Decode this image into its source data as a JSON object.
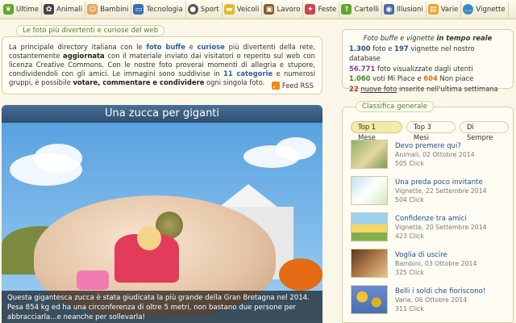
{
  "nav": [
    {
      "label": "Ultime",
      "icon": "leaf-icon",
      "color": "#5ca832"
    },
    {
      "label": "Animali",
      "icon": "paw-icon",
      "color": "#444444"
    },
    {
      "label": "Bambini",
      "icon": "child-face-icon",
      "color": "#e8a35a"
    },
    {
      "label": "Tecnologia",
      "icon": "monitor-icon",
      "color": "#3a6fb5"
    },
    {
      "label": "Sport",
      "icon": "soccer-ball-icon",
      "color": "#555555"
    },
    {
      "label": "Veicoli",
      "icon": "car-icon",
      "color": "#e6b82a"
    },
    {
      "label": "Lavoro",
      "icon": "briefcase-icon",
      "color": "#8a5a2a"
    },
    {
      "label": "Feste",
      "icon": "party-icon",
      "color": "#d04050"
    },
    {
      "label": "Cartelli",
      "icon": "signpost-icon",
      "color": "#5ca832"
    },
    {
      "label": "Illusioni",
      "icon": "eye-icon",
      "color": "#4a6aa8"
    },
    {
      "label": "Varie",
      "icon": "folder-icon",
      "color": "#e8a82a"
    },
    {
      "label": "Vignette",
      "icon": "speech-bubble-icon",
      "color": "#3a8ac8"
    }
  ],
  "intro": {
    "legend": "Le foto più divertenti e curiose del web",
    "p1": "La principale directory italiana con le ",
    "b1": "foto buffe",
    "p2": " e ",
    "b2": "curiose",
    "p3": " più divertenti della rete, costantemente ",
    "b3": "aggiornata",
    "p4": " con il materiale inviato dai visitatori o reperito sul web con licenza Creative Commons. Con le nostre foto proverai momenti di allegria e stupore, condividendoli con gli amici. Le immagini sono suddivise in ",
    "b4": "11 categorie",
    "p5": " e numerosi gruppi, è possibile ",
    "b5": "votare, commentare e condividere",
    "p6": " ogni singola foto.",
    "rss": "Feed RSS"
  },
  "stats": {
    "title_pre": "Foto buffe e vignette ",
    "title_b": "in tempo reale",
    "photos": "1.300",
    "l1a": " foto e ",
    "cartoons": "197",
    "l1b": " vignette nel nostro database",
    "views": "56.771",
    "l2": " foto visualizzate dagli utenti",
    "likes": "1.060",
    "l3a": " voti Mi Piace e ",
    "dislikes": "604",
    "l3b": " Non piace",
    "new": "22",
    "newlabel": "nuove foto",
    "l4": " inserite nell'ultima settimana"
  },
  "feature": {
    "title": "Una zucca per giganti",
    "caption": "Questa gigantesca zucca è stata giudicata la più grande della Gran Bretagna nel 2014. Pesa 854 kg ed ha una circonferenza di oltre 5 metri, non bastano due persone per abbracciarla...e neanche per sollevarla!"
  },
  "ranking": {
    "legend": "Classifica generale",
    "tabs": [
      "Top 1 Mese",
      "Top 3 Mesi",
      "Di Sempre"
    ],
    "items": [
      {
        "title": "Devo premere qui?",
        "meta": "Animali, 02 Ottobre 2014",
        "clicks": "505 Click"
      },
      {
        "title": "Una preda poco invitante",
        "meta": "Vignette, 22 Settembre 2014",
        "clicks": "504 Click"
      },
      {
        "title": "Confidenze tra amici",
        "meta": "Vignette, 20 Settembre 2014",
        "clicks": "423 Click"
      },
      {
        "title": "Voglia di uscire",
        "meta": "Bambini, 03 Ottobre 2014",
        "clicks": "325 Click"
      },
      {
        "title": "Belli i soldi che fioriscono!",
        "meta": "Varie, 06 Ottobre 2014",
        "clicks": "311 Click"
      }
    ]
  }
}
